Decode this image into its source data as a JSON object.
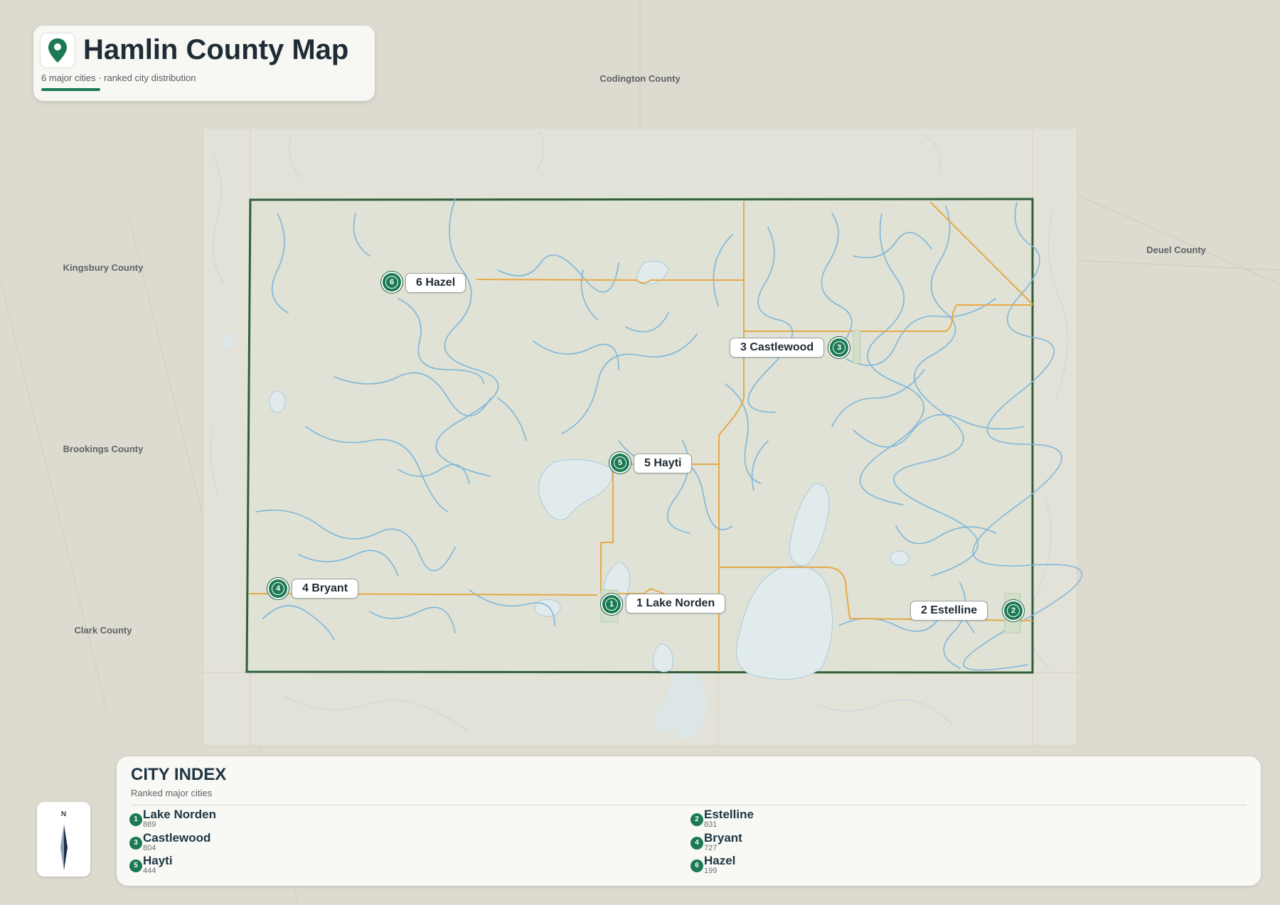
{
  "header": {
    "title": "Hamlin County Map",
    "subtitle": "6 major cities · ranked city distribution",
    "pin_icon": "map-pin-icon"
  },
  "neighbor_counties": [
    {
      "id": "codington",
      "label": "Codington County"
    },
    {
      "id": "kingsbury",
      "label": "Kingsbury County"
    },
    {
      "id": "deuel",
      "label": "Deuel County"
    },
    {
      "id": "brookings",
      "label": "Brookings County"
    },
    {
      "id": "clark",
      "label": "Clark County"
    }
  ],
  "cities": [
    {
      "rank": "1",
      "name": "Lake Norden",
      "label": "1 Lake Norden",
      "population": "889"
    },
    {
      "rank": "2",
      "name": "Estelline",
      "label": "2 Estelline",
      "population": "831"
    },
    {
      "rank": "3",
      "name": "Castlewood",
      "label": "3 Castlewood",
      "population": "804"
    },
    {
      "rank": "4",
      "name": "Bryant",
      "label": "4 Bryant",
      "population": "727"
    },
    {
      "rank": "5",
      "name": "Hayti",
      "label": "5 Hayti",
      "population": "444"
    },
    {
      "rank": "6",
      "name": "Hazel",
      "label": "6 Hazel",
      "population": "199"
    }
  ],
  "index": {
    "title": "CITY INDEX",
    "subtitle": "Ranked major cities"
  },
  "compass": {
    "label": "N",
    "icon": "compass-needle-icon"
  },
  "colors": {
    "accent": "#1b7a52",
    "county_boundary": "#2f5f3a",
    "roads": "#e7a948",
    "water": "#7fb6dc",
    "lakes": "#e1ebec",
    "land": "#dfe0d3",
    "background": "#dddad0"
  }
}
